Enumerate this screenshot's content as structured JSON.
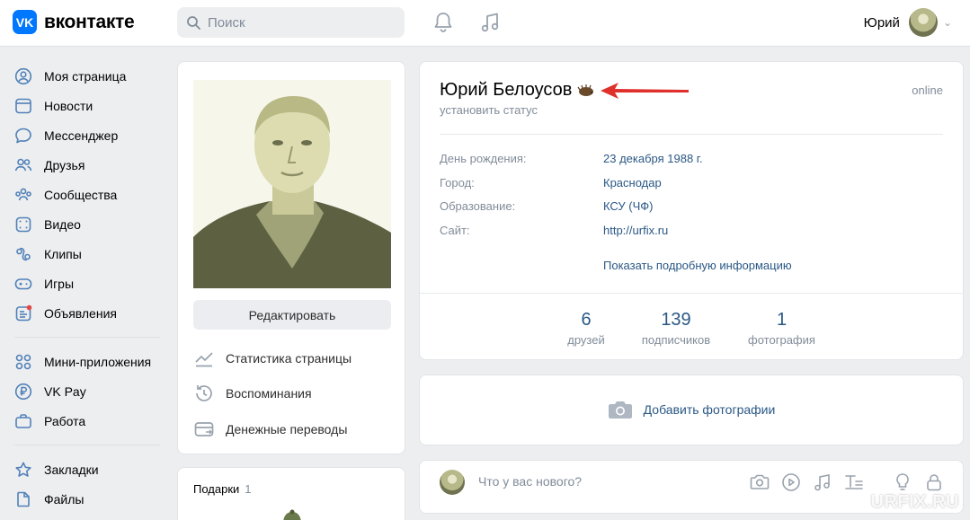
{
  "header": {
    "logo_mark": "VK",
    "logo_text": "вконтакте",
    "search_placeholder": "Поиск",
    "user_name": "Юрий"
  },
  "nav": {
    "group1": [
      {
        "label": "Моя страница",
        "icon": "user-circle-icon"
      },
      {
        "label": "Новости",
        "icon": "newspaper-icon"
      },
      {
        "label": "Мессенджер",
        "icon": "message-icon"
      },
      {
        "label": "Друзья",
        "icon": "friends-icon"
      },
      {
        "label": "Сообщества",
        "icon": "communities-icon"
      },
      {
        "label": "Видео",
        "icon": "video-icon"
      },
      {
        "label": "Клипы",
        "icon": "clips-icon"
      },
      {
        "label": "Игры",
        "icon": "gamepad-icon"
      },
      {
        "label": "Объявления",
        "icon": "ads-icon"
      }
    ],
    "group2": [
      {
        "label": "Мини-приложения",
        "icon": "apps-icon"
      },
      {
        "label": "VK Pay",
        "icon": "vkpay-icon"
      },
      {
        "label": "Работа",
        "icon": "briefcase-icon"
      }
    ],
    "group3": [
      {
        "label": "Закладки",
        "icon": "star-icon"
      },
      {
        "label": "Файлы",
        "icon": "file-icon"
      }
    ]
  },
  "profile_side": {
    "edit_label": "Редактировать",
    "links": [
      {
        "label": "Статистика страницы",
        "icon": "stats-icon"
      },
      {
        "label": "Воспоминания",
        "icon": "history-icon"
      },
      {
        "label": "Денежные переводы",
        "icon": "money-transfer-icon"
      }
    ],
    "gifts_label": "Подарки",
    "gifts_count": "1"
  },
  "profile": {
    "name": "Юрий Белоусов",
    "status_link": "установить статус",
    "online": "online",
    "info": [
      {
        "label": "День рождения:",
        "value": "23 декабря 1988 г."
      },
      {
        "label": "Город:",
        "value": "Краснодар"
      },
      {
        "label": "Образование:",
        "value": "КСУ (ЧФ)"
      },
      {
        "label": "Сайт:",
        "value": "http://urfix.ru"
      }
    ],
    "more_link": "Показать подробную информацию",
    "counters": [
      {
        "num": "6",
        "label": "друзей"
      },
      {
        "num": "139",
        "label": "подписчиков"
      },
      {
        "num": "1",
        "label": "фотография"
      }
    ]
  },
  "photos": {
    "add_label": "Добавить фотографии"
  },
  "post": {
    "placeholder": "Что у вас нового?"
  },
  "watermark": "URFIX.RU",
  "colors": {
    "accent": "#0077ff",
    "link": "#2a5885",
    "muted": "#818c99",
    "arrow": "#e0302b"
  }
}
